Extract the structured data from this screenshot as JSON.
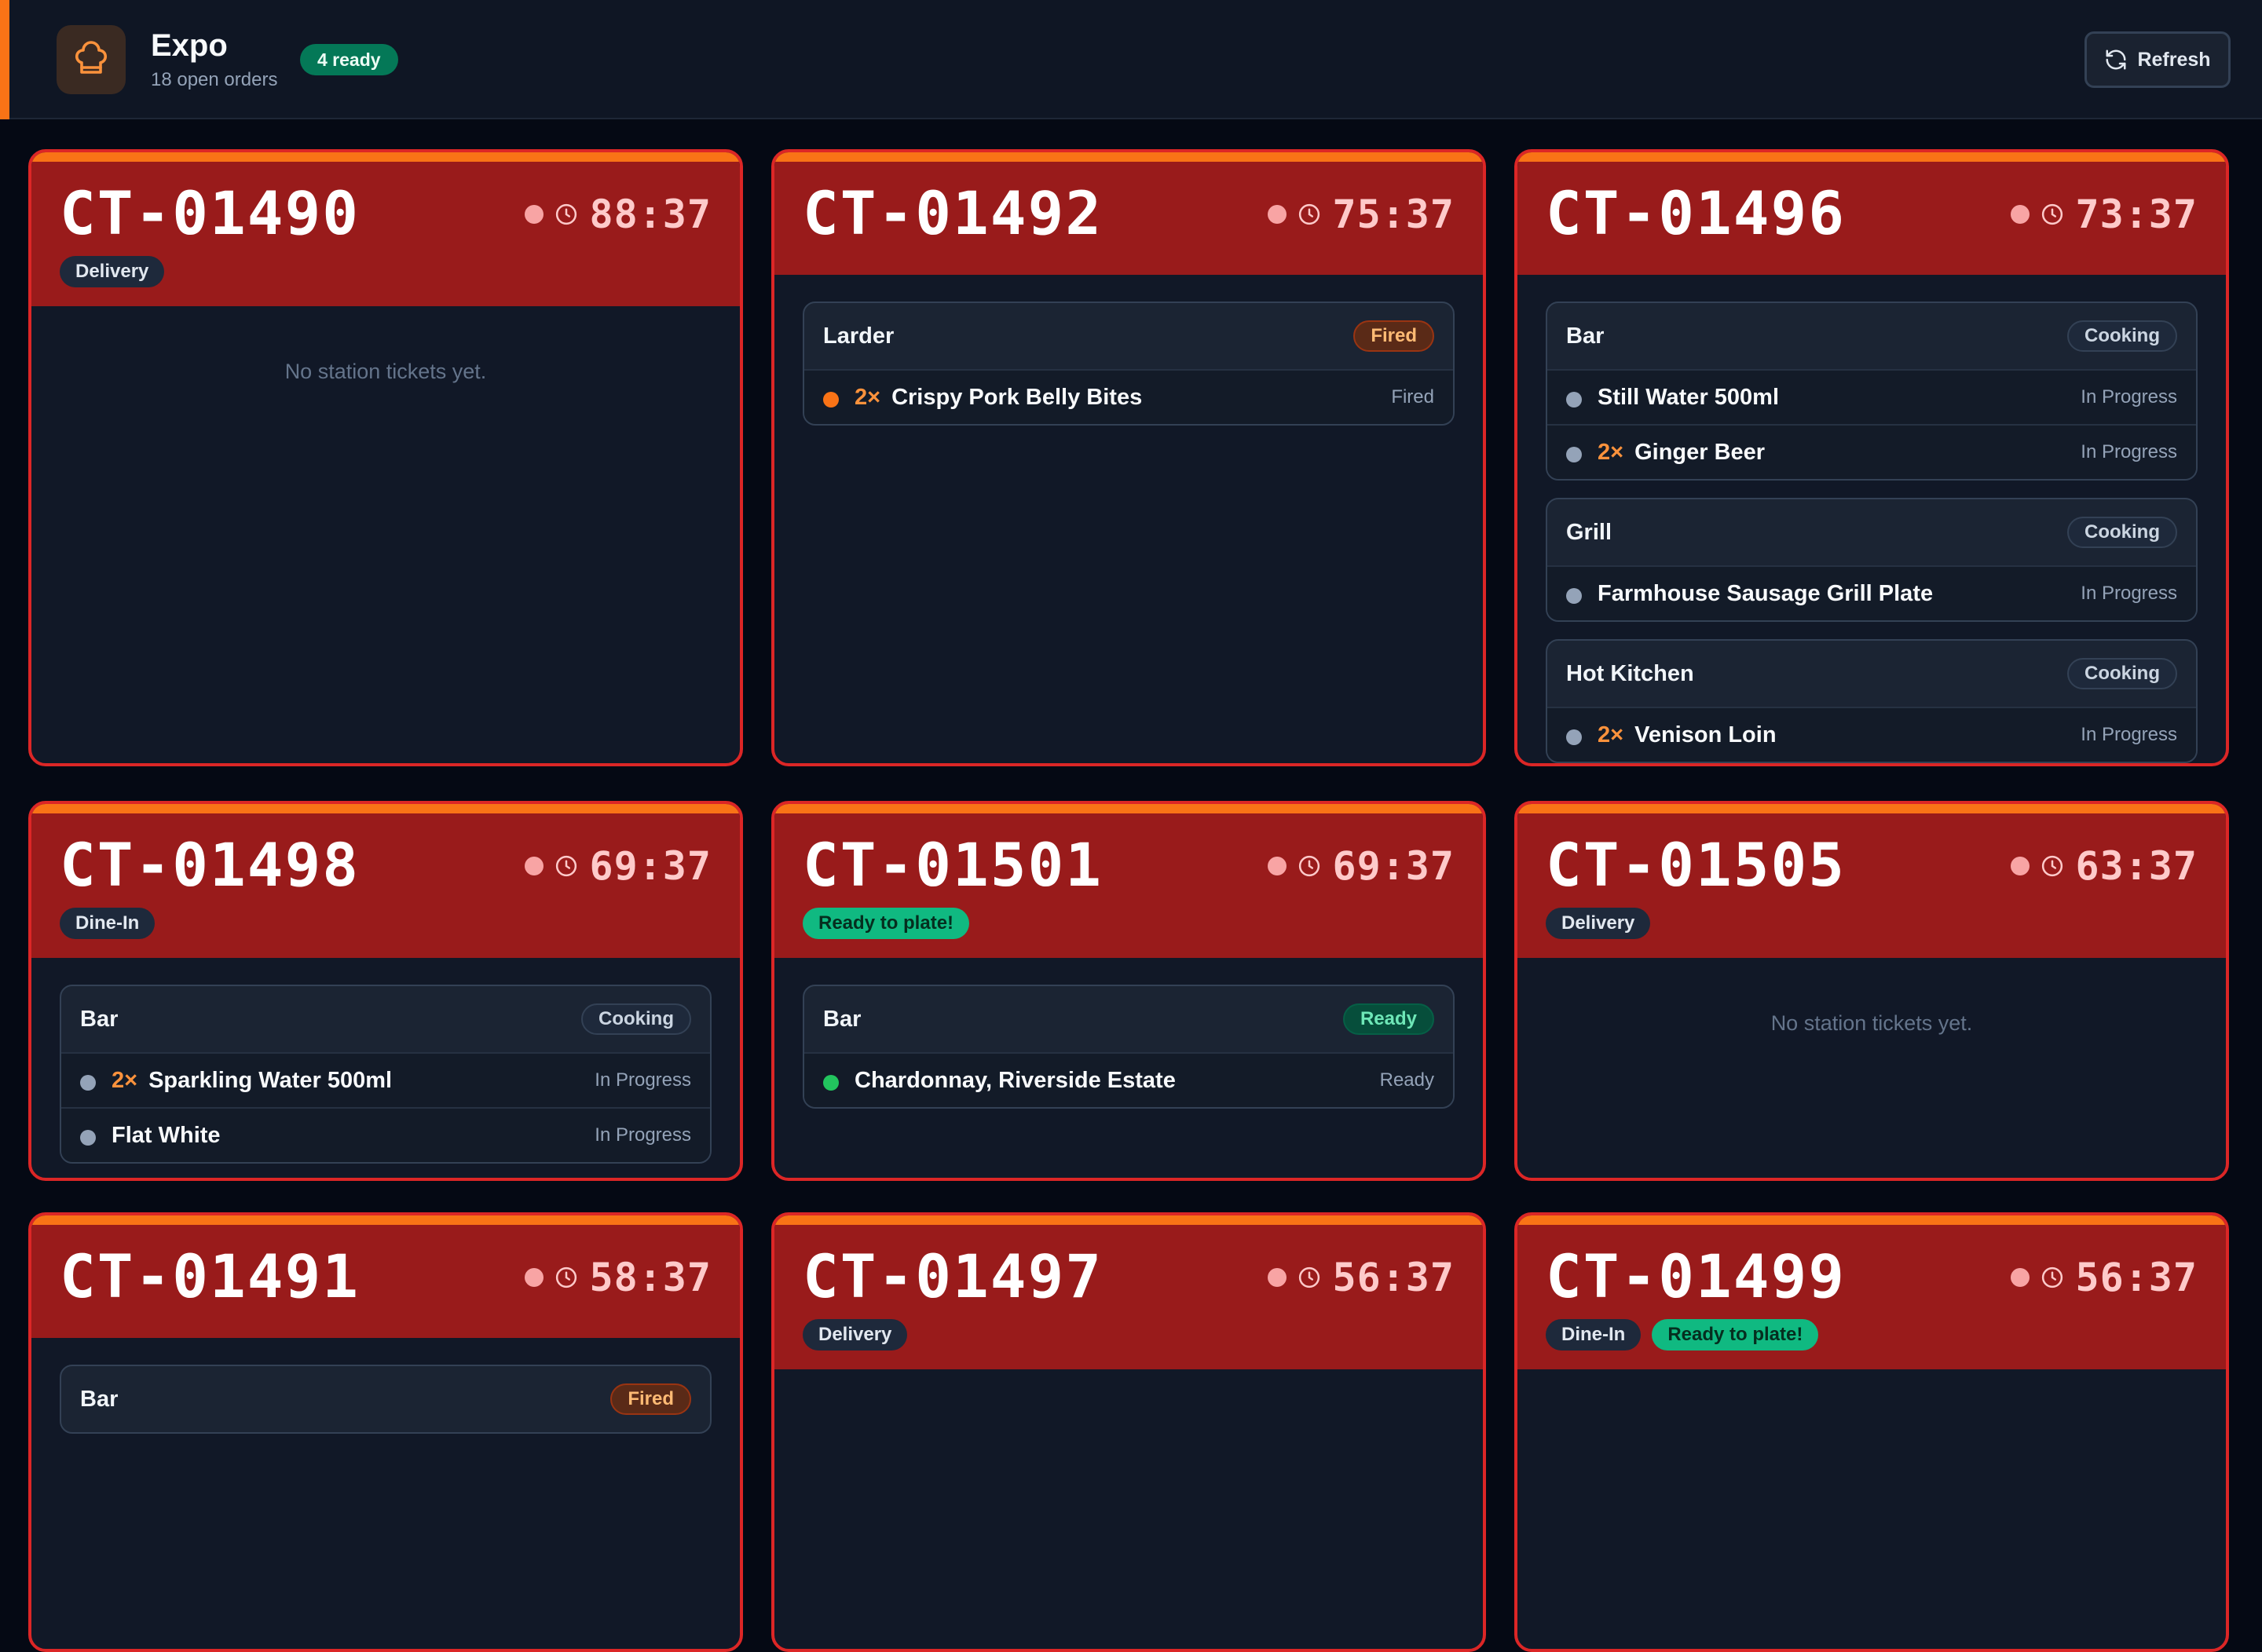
{
  "header": {
    "title": "Expo",
    "subtitle": "18 open orders",
    "ready_badge": "4 ready",
    "refresh_label": "Refresh",
    "accent_color": "#f97316"
  },
  "orders": [
    {
      "id": "CT-01490",
      "timer": "88:37",
      "type": "Delivery",
      "ready": "",
      "empty": "No station tickets yet.",
      "tickets": []
    },
    {
      "id": "CT-01492",
      "timer": "75:37",
      "type": "",
      "ready": "",
      "empty": "",
      "tickets": [
        {
          "station": "Larder",
          "status": "Fired",
          "items": [
            {
              "qty": "2×",
              "name": "Crispy Pork Belly Bites",
              "status": "Fired"
            }
          ]
        }
      ]
    },
    {
      "id": "CT-01496",
      "timer": "73:37",
      "type": "",
      "ready": "",
      "empty": "",
      "tickets": [
        {
          "station": "Bar",
          "status": "Cooking",
          "items": [
            {
              "qty": "",
              "name": "Still Water 500ml",
              "status": "In Progress"
            },
            {
              "qty": "2×",
              "name": "Ginger Beer",
              "status": "In Progress"
            }
          ]
        },
        {
          "station": "Grill",
          "status": "Cooking",
          "items": [
            {
              "qty": "",
              "name": "Farmhouse Sausage Grill Plate",
              "status": "In Progress"
            }
          ]
        },
        {
          "station": "Hot Kitchen",
          "status": "Cooking",
          "items": [
            {
              "qty": "2×",
              "name": "Venison Loin",
              "status": "In Progress"
            }
          ]
        }
      ]
    },
    {
      "id": "CT-01498",
      "timer": "69:37",
      "type": "Dine-In",
      "ready": "",
      "empty": "",
      "tickets": [
        {
          "station": "Bar",
          "status": "Cooking",
          "items": [
            {
              "qty": "2×",
              "name": "Sparkling Water 500ml",
              "status": "In Progress"
            },
            {
              "qty": "",
              "name": "Flat White",
              "status": "In Progress"
            }
          ]
        }
      ]
    },
    {
      "id": "CT-01501",
      "timer": "69:37",
      "type": "",
      "ready": "Ready to plate!",
      "empty": "",
      "tickets": [
        {
          "station": "Bar",
          "status": "Ready",
          "items": [
            {
              "qty": "",
              "name": "Chardonnay, Riverside Estate",
              "status": "Ready"
            }
          ]
        }
      ]
    },
    {
      "id": "CT-01505",
      "timer": "63:37",
      "type": "Delivery",
      "ready": "",
      "empty": "No station tickets yet.",
      "tickets": []
    },
    {
      "id": "CT-01491",
      "timer": "58:37",
      "type": "",
      "ready": "",
      "empty": "",
      "tickets": [
        {
          "station": "Bar",
          "status": "Fired",
          "items": []
        }
      ]
    },
    {
      "id": "CT-01497",
      "timer": "56:37",
      "type": "Delivery",
      "ready": "",
      "empty": "",
      "tickets": []
    },
    {
      "id": "CT-01499",
      "timer": "56:37",
      "type": "Dine-In",
      "ready": "Ready to plate!",
      "empty": "",
      "tickets": []
    }
  ]
}
